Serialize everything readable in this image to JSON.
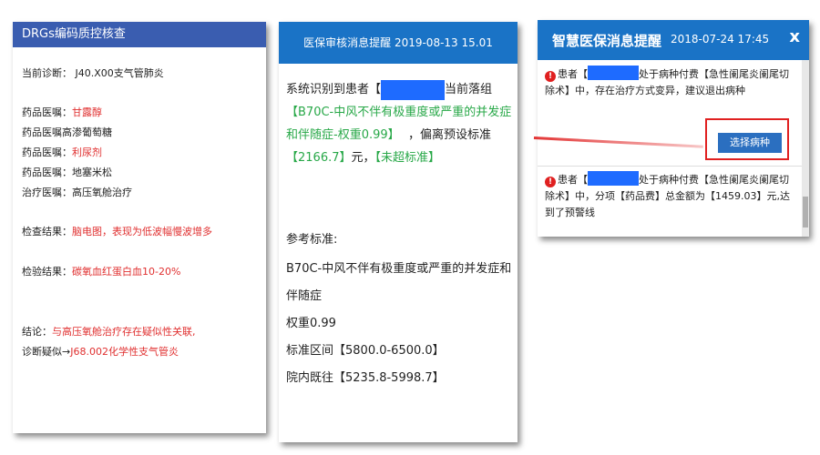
{
  "panel1": {
    "title": "DRGs编码质控核查",
    "diagnosis": "当前诊断： J40.X00支气管肺炎",
    "orders": [
      {
        "label": "药品医嘱：",
        "value": "甘露醇",
        "highlight": true
      },
      {
        "label": "药品医嘱",
        "value": "高渗葡萄糖",
        "highlight": false
      },
      {
        "label": "药品医嘱：",
        "value": "利尿剂",
        "highlight": true
      },
      {
        "label": "药品医嘱：",
        "value": "地塞米松",
        "highlight": false
      },
      {
        "label": "治疗医嘱：",
        "value": "高压氧舱治疗",
        "highlight": false
      }
    ],
    "exam_label": "检查结果：",
    "exam_value": "脑电图，表现为低波幅慢波增多",
    "test_label": "检验结果：",
    "test_value": "碳氧血红蛋白血10-20%",
    "conclusion_label": "结论：",
    "conclusion_value": "与高压氧舱治疗存在疑似性关联,",
    "suspect_label": "诊断疑似→",
    "suspect_value": "J68.002化学性支气管炎"
  },
  "panel2": {
    "title": "医保审核消息提醒 2019-08-13 15.01",
    "msg_prefix": "系统识别到患者【",
    "msg_suffix": "当前落组",
    "group": "【B70C-中风不伴有极重度或严重的并发症和伴随症-权重0.99】",
    "deviation": "，偏离预设标准",
    "amount": "【2166.7】",
    "unit": "元，",
    "status": "【未超标准】",
    "ref_title": "参考标准:",
    "ref_group_line1": "B70C-中风不伴有极重度或严重的并发症和",
    "ref_group_line2": "伴随症",
    "ref_weight": "权重0.99",
    "ref_interval": "标准区间【5800.0-6500.0】",
    "ref_hospital": "院内既往【5235.8-5998.7】"
  },
  "panel3": {
    "title": "智慧医保消息提醒",
    "datetime": "2018-07-24 17:45",
    "close": "x",
    "msg1_prefix": "患者【",
    "msg1_text": "处于病种付费【急性阑尾炎阑尾切除术】中，存在治疗方式变异，建议退出病种",
    "button": "选择病种",
    "msg2_prefix": "患者【",
    "msg2_text": "处于病种付费【急性阑尾炎阑尾切除术】中，分项【药品费】总金额为【1459.03】元,达到了预警线"
  }
}
